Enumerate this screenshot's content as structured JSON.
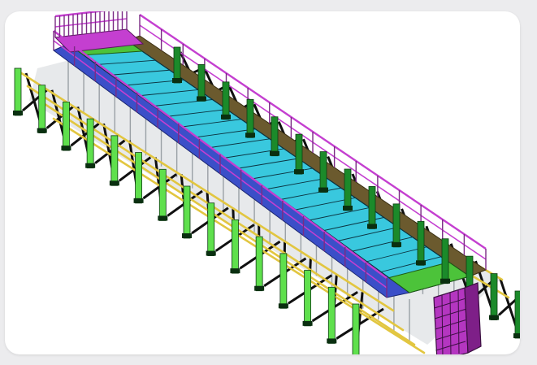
{
  "image": {
    "subject": "isometric-scaffold-bridge-render",
    "colors": {
      "page_bg": "#ececee",
      "card_bg": "#ffffff",
      "deck": "#39c8de",
      "deck_line": "#0b3340",
      "walkway_left": "#3b4fc8",
      "walkway_right": "#6b5a2e",
      "end_platform": "#4cc33a",
      "rail": "#c43fd0",
      "post": "#1b8a2a",
      "post_light": "#5fe04d",
      "brace": "#101010",
      "tube": "#e2c640",
      "frame": "#9aa0a6",
      "base": "#f0d060",
      "tower": "#b436c0"
    }
  }
}
